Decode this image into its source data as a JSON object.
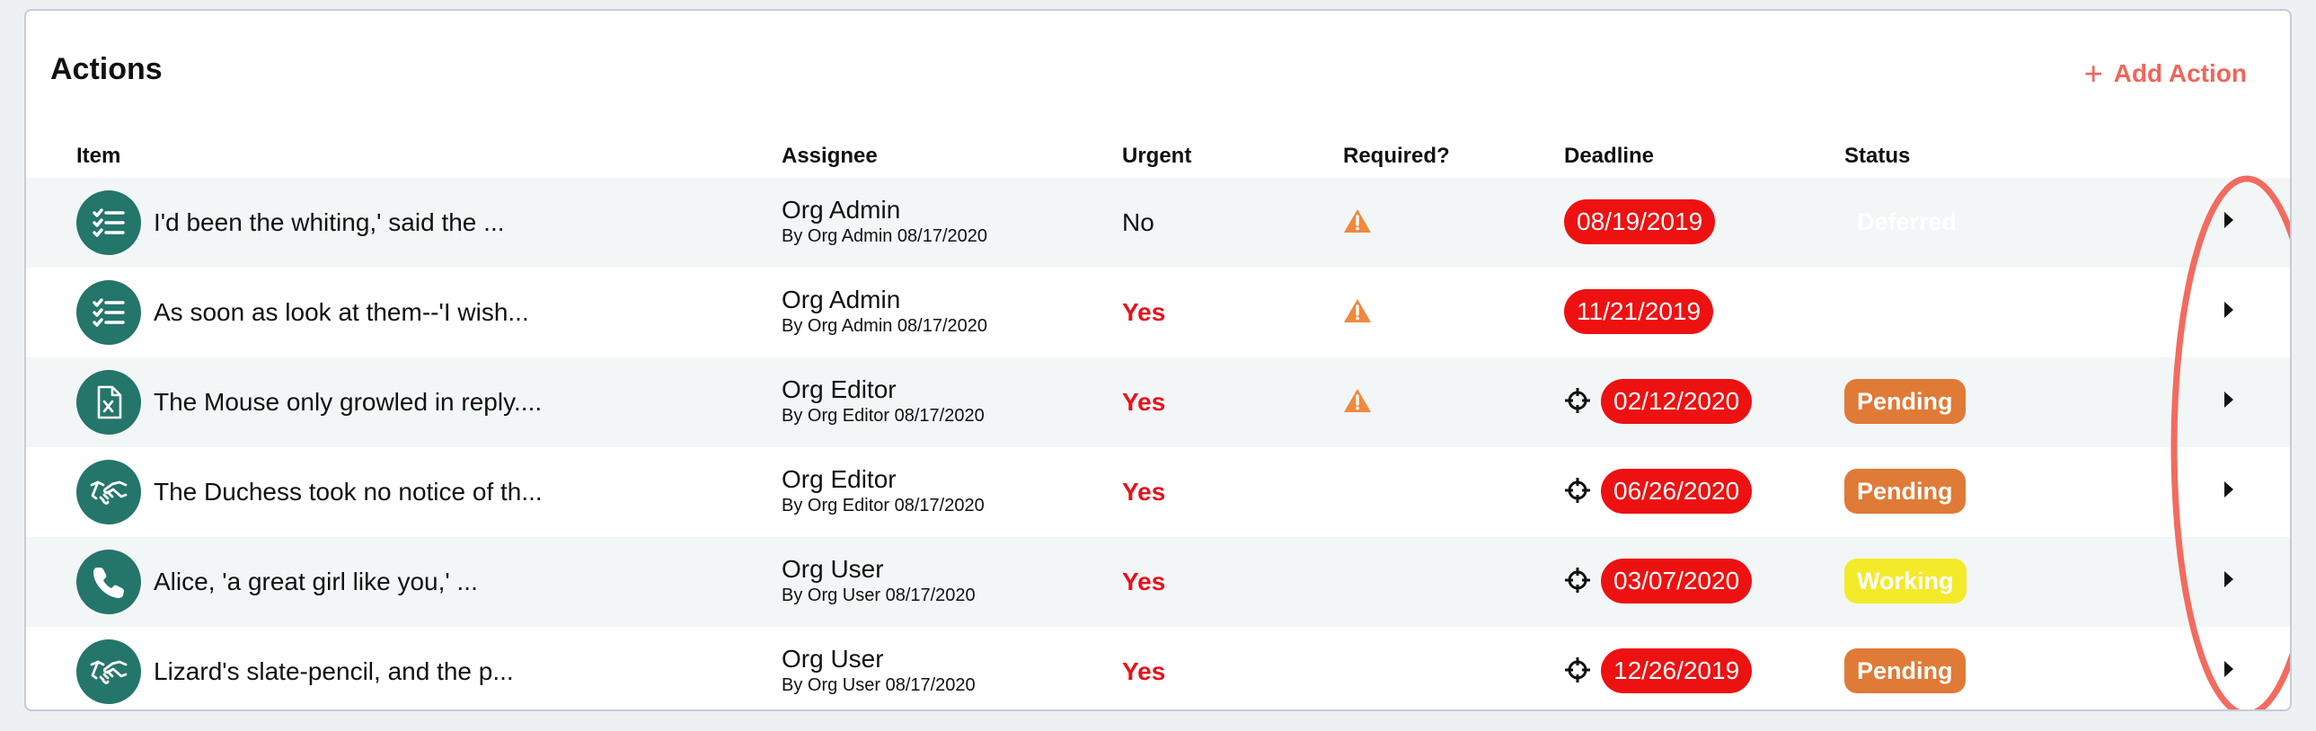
{
  "panel": {
    "title": "Actions",
    "add_action_label": "Add Action"
  },
  "columns": {
    "item": "Item",
    "assignee": "Assignee",
    "urgent": "Urgent",
    "required": "Required?",
    "deadline": "Deadline",
    "status": "Status"
  },
  "rows": [
    {
      "icon": "checklist-icon",
      "item": "I'd been the whiting,' said the ...",
      "assignee": "Org Admin",
      "by": "By Org Admin 08/17/2020",
      "urgent": "No",
      "required_warning": true,
      "deadline_target": false,
      "deadline": "08/19/2019",
      "status": "Deferred"
    },
    {
      "icon": "checklist-icon",
      "item": "As soon as look at them--'I wish...",
      "assignee": "Org Admin",
      "by": "By Org Admin 08/17/2020",
      "urgent": "Yes",
      "required_warning": true,
      "deadline_target": false,
      "deadline": "11/21/2019",
      "status": ""
    },
    {
      "icon": "excel-file-icon",
      "item": "The Mouse only growled in reply....",
      "assignee": "Org Editor",
      "by": "By Org Editor 08/17/2020",
      "urgent": "Yes",
      "required_warning": true,
      "deadline_target": true,
      "deadline": "02/12/2020",
      "status": "Pending"
    },
    {
      "icon": "handshake-icon",
      "item": "The Duchess took no notice of th...",
      "assignee": "Org Editor",
      "by": "By Org Editor 08/17/2020",
      "urgent": "Yes",
      "required_warning": false,
      "deadline_target": true,
      "deadline": "06/26/2020",
      "status": "Pending"
    },
    {
      "icon": "phone-icon",
      "item": "Alice, 'a great girl like you,' ...",
      "assignee": "Org User",
      "by": "By Org User 08/17/2020",
      "urgent": "Yes",
      "required_warning": false,
      "deadline_target": true,
      "deadline": "03/07/2020",
      "status": "Working"
    },
    {
      "icon": "handshake-icon",
      "item": "Lizard's slate-pencil, and the p...",
      "assignee": "Org User",
      "by": "By Org User 08/17/2020",
      "urgent": "Yes",
      "required_warning": false,
      "deadline_target": true,
      "deadline": "12/26/2019",
      "status": "Pending"
    }
  ],
  "colors": {
    "accent": "#f0655b",
    "avatar_bg": "#24756a",
    "deadline_bg": "#ee1111",
    "urgent_yes": "#e8111b",
    "pending": "#e07a37",
    "working": "#f3ea2a",
    "warning": "#f0883e"
  }
}
